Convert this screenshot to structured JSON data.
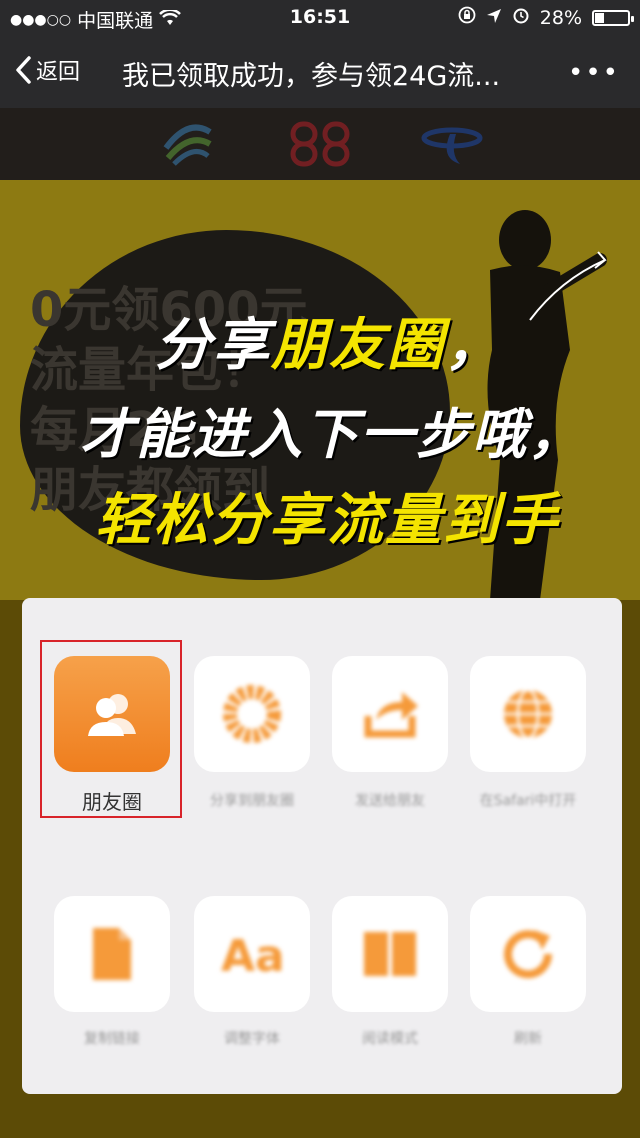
{
  "status": {
    "carrier": "中国联通",
    "time": "16:51",
    "battery": "28%",
    "battery_level": 0.28
  },
  "nav": {
    "back_label": "返回",
    "title": "我已领取成功，参与领24G流..."
  },
  "banner": {
    "bubble_text": [
      "0元领600元",
      "流量年包！",
      "每月2G",
      "朋友都领到"
    ],
    "line1_white": "分享",
    "line1_yellow": "朋友圈",
    "line1_tail": "，",
    "line2": "才能进入下一步哦，",
    "line3": "轻松分享流量到手"
  },
  "share": {
    "items_row1": [
      {
        "label": "朋友圈",
        "icon": "moments-icon"
      },
      {
        "label": "分享到朋友圈",
        "icon": "donut-icon"
      },
      {
        "label": "发送给朋友",
        "icon": "share-arrow-icon"
      },
      {
        "label": "在Safari中打开",
        "icon": "globe-icon"
      }
    ],
    "items_row2": [
      {
        "label": "复制链接",
        "icon": "document-icon"
      },
      {
        "label": "调整字体",
        "icon": "font-icon"
      },
      {
        "label": "阅读模式",
        "icon": "book-icon"
      },
      {
        "label": "刷新",
        "icon": "refresh-icon"
      }
    ]
  },
  "colors": {
    "accent_orange": "#ef7e1e",
    "highlight_red": "#d8232a",
    "banner_yellow": "#f4e400"
  }
}
